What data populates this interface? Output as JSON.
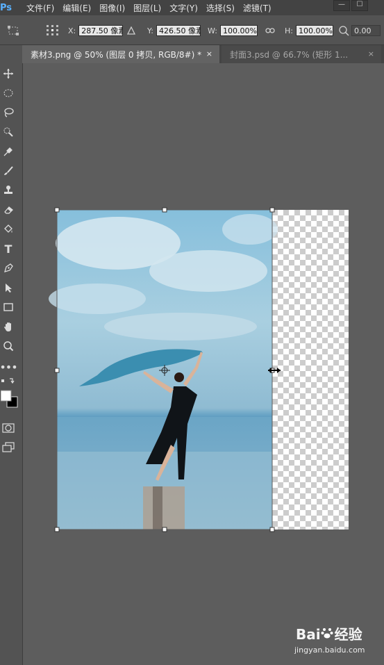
{
  "app": {
    "logo": "Ps"
  },
  "menu": [
    "文件(F)",
    "编辑(E)",
    "图像(I)",
    "图层(L)",
    "文字(Y)",
    "选择(S)",
    "滤镜(T)"
  ],
  "window_controls": [
    "—",
    "☐"
  ],
  "options": {
    "x_label": "X:",
    "x_value": "287.50 像素",
    "y_label": "Y:",
    "y_value": "426.50 像素",
    "w_label": "W:",
    "w_value": "100.00%",
    "h_label": "H:",
    "h_value": "100.00%",
    "angle_value": "0.00"
  },
  "tabs": [
    {
      "label": "素材3.png @ 50% (图层 0 拷贝, RGB/8#) *",
      "close": "×"
    },
    {
      "label": "封面3.psd @ 66.7% (矩形 1...",
      "close": "×"
    }
  ],
  "tools": [
    "move-tool",
    "marquee-tool",
    "lasso-tool",
    "quick-select-tool",
    "eyedropper-tool",
    "brush-tool",
    "stamp-tool",
    "eraser-tool",
    "paint-bucket-tool",
    "type-tool",
    "pen-tool",
    "path-select-tool",
    "rectangle-tool",
    "hand-tool",
    "zoom-tool",
    "more-tools"
  ],
  "tool_glyphs": {
    "type": "T"
  },
  "watermark": {
    "brand": "Bai",
    "brand2": "经验",
    "url": "jingyan.baidu.com"
  },
  "colors": {
    "accent": "#5ab1ff",
    "background": "#5b5b5b",
    "panel": "#535353"
  }
}
